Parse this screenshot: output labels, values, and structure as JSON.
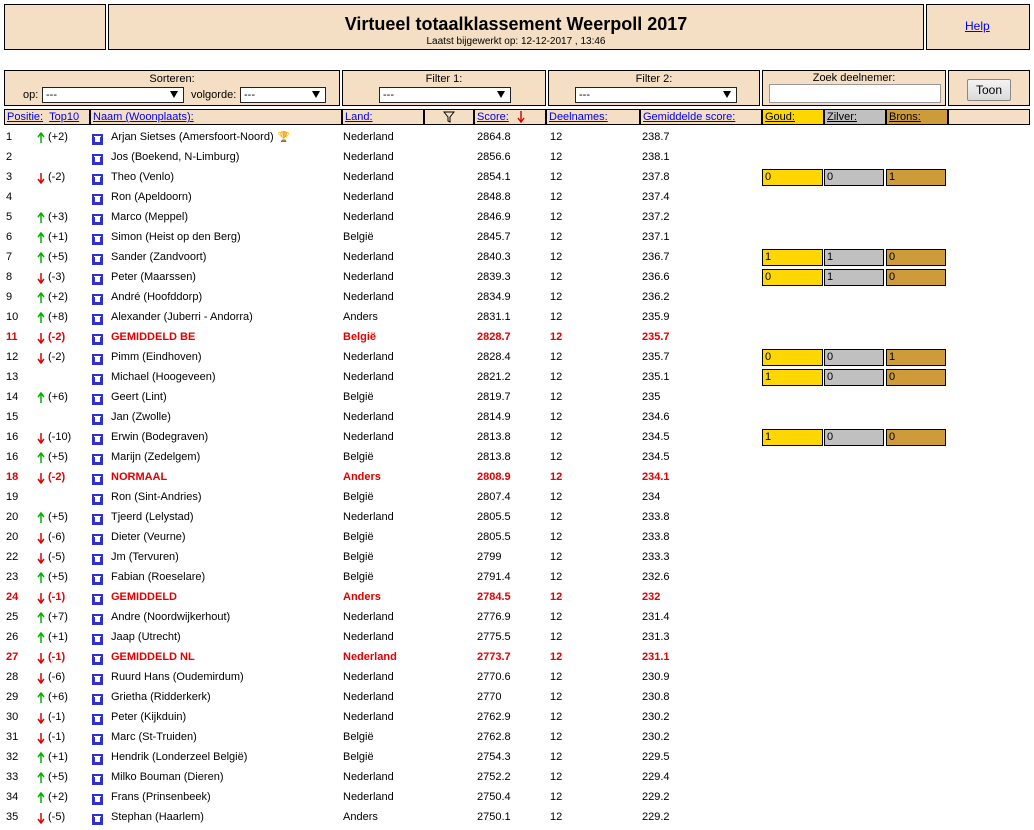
{
  "header": {
    "title": "Virtueel totaalklassement Weerpoll 2017",
    "subtitle": "Laatst bijgewerkt op: 12-12-2017 , 13:46",
    "help_label": "Help"
  },
  "controls": {
    "sort_label": "Sorteren:",
    "op_label": "op:",
    "op_value": "---",
    "volgorde_label": "volgorde:",
    "volgorde_value": "---",
    "filter1_label": "Filter 1:",
    "filter1_value": "---",
    "filter2_label": "Filter 2:",
    "filter2_value": "---",
    "search_label": "Zoek deelnemer:",
    "search_value": "",
    "toon_label": "Toon"
  },
  "columns": {
    "positie": "Positie:",
    "top10": "Top10",
    "naam": "Naam (Woonplaats):",
    "land": "Land:",
    "score": "Score:",
    "deelnames": "Deelnames:",
    "gemiddelde": "Gemiddelde score:",
    "goud": "Goud:",
    "zilver": "Zilver:",
    "brons": "Brons:"
  },
  "colors": {
    "gold": "#ffd700",
    "silver": "#c0c0c0",
    "bronze": "#cd9b3a",
    "highlight": "#e00000",
    "header_bg": "#f5dfc4"
  },
  "rows": [
    {
      "pos": "1",
      "dir": "up",
      "change": "(+2)",
      "name": "Arjan Sietses (Amersfoort-Noord)",
      "trophy": true,
      "land": "Nederland",
      "score": "2864.8",
      "deel": "12",
      "gem": "238.7"
    },
    {
      "pos": "2",
      "dir": "",
      "change": "",
      "name": "Jos (Boekend, N-Limburg)",
      "land": "Nederland",
      "score": "2856.6",
      "deel": "12",
      "gem": "238.1"
    },
    {
      "pos": "3",
      "dir": "down",
      "change": "(-2)",
      "name": "Theo (Venlo)",
      "land": "Nederland",
      "score": "2854.1",
      "deel": "12",
      "gem": "237.8",
      "goud": "0",
      "zilver": "0",
      "brons": "1"
    },
    {
      "pos": "4",
      "dir": "",
      "change": "",
      "name": "Ron (Apeldoorn)",
      "land": "Nederland",
      "score": "2848.8",
      "deel": "12",
      "gem": "237.4"
    },
    {
      "pos": "5",
      "dir": "up",
      "change": "(+3)",
      "name": "Marco (Meppel)",
      "land": "Nederland",
      "score": "2846.9",
      "deel": "12",
      "gem": "237.2"
    },
    {
      "pos": "6",
      "dir": "up",
      "change": "(+1)",
      "name": "Simon (Heist op den Berg)",
      "land": "België",
      "score": "2845.7",
      "deel": "12",
      "gem": "237.1"
    },
    {
      "pos": "7",
      "dir": "up",
      "change": "(+5)",
      "name": "Sander (Zandvoort)",
      "land": "Nederland",
      "score": "2840.3",
      "deel": "12",
      "gem": "236.7",
      "goud": "1",
      "zilver": "1",
      "brons": "0"
    },
    {
      "pos": "8",
      "dir": "down",
      "change": "(-3)",
      "name": "Peter (Maarssen)",
      "land": "Nederland",
      "score": "2839.3",
      "deel": "12",
      "gem": "236.6",
      "goud": "0",
      "zilver": "1",
      "brons": "0"
    },
    {
      "pos": "9",
      "dir": "up",
      "change": "(+2)",
      "name": "André (Hoofddorp)",
      "land": "Nederland",
      "score": "2834.9",
      "deel": "12",
      "gem": "236.2"
    },
    {
      "pos": "10",
      "dir": "up",
      "change": "(+8)",
      "name": "Alexander (Juberri - Andorra)",
      "land": "Anders",
      "score": "2831.1",
      "deel": "12",
      "gem": "235.9"
    },
    {
      "pos": "11",
      "dir": "down",
      "change": "(-2)",
      "name": "GEMIDDELD BE",
      "hl": true,
      "land": "België",
      "score": "2828.7",
      "deel": "12",
      "gem": "235.7"
    },
    {
      "pos": "12",
      "dir": "down",
      "change": "(-2)",
      "name": "Pimm (Eindhoven)",
      "land": "Nederland",
      "score": "2828.4",
      "deel": "12",
      "gem": "235.7",
      "goud": "0",
      "zilver": "0",
      "brons": "1"
    },
    {
      "pos": "13",
      "dir": "",
      "change": "",
      "name": "Michael (Hoogeveen)",
      "land": "Nederland",
      "score": "2821.2",
      "deel": "12",
      "gem": "235.1",
      "goud": "1",
      "zilver": "0",
      "brons": "0"
    },
    {
      "pos": "14",
      "dir": "up",
      "change": "(+6)",
      "name": "Geert (Lint)",
      "land": "België",
      "score": "2819.7",
      "deel": "12",
      "gem": "235"
    },
    {
      "pos": "15",
      "dir": "",
      "change": "",
      "name": "Jan (Zwolle)",
      "land": "Nederland",
      "score": "2814.9",
      "deel": "12",
      "gem": "234.6"
    },
    {
      "pos": "16",
      "dir": "down",
      "change": "(-10)",
      "name": "Erwin (Bodegraven)",
      "land": "Nederland",
      "score": "2813.8",
      "deel": "12",
      "gem": "234.5",
      "goud": "1",
      "zilver": "0",
      "brons": "0"
    },
    {
      "pos": "16",
      "dir": "up",
      "change": "(+5)",
      "name": "Marijn (Zedelgem)",
      "land": "België",
      "score": "2813.8",
      "deel": "12",
      "gem": "234.5"
    },
    {
      "pos": "18",
      "dir": "down",
      "change": "(-2)",
      "name": "NORMAAL",
      "hl": true,
      "land": "Anders",
      "score": "2808.9",
      "deel": "12",
      "gem": "234.1"
    },
    {
      "pos": "19",
      "dir": "",
      "change": "",
      "name": "Ron (Sint-Andries)",
      "land": "België",
      "score": "2807.4",
      "deel": "12",
      "gem": "234"
    },
    {
      "pos": "20",
      "dir": "up",
      "change": "(+5)",
      "name": "Tjeerd (Lelystad)",
      "land": "Nederland",
      "score": "2805.5",
      "deel": "12",
      "gem": "233.8"
    },
    {
      "pos": "20",
      "dir": "down",
      "change": "(-6)",
      "name": "Dieter (Veurne)",
      "land": "België",
      "score": "2805.5",
      "deel": "12",
      "gem": "233.8"
    },
    {
      "pos": "22",
      "dir": "down",
      "change": "(-5)",
      "name": "Jm (Tervuren)",
      "land": "België",
      "score": "2799",
      "deel": "12",
      "gem": "233.3"
    },
    {
      "pos": "23",
      "dir": "up",
      "change": "(+5)",
      "name": "Fabian (Roeselare)",
      "land": "België",
      "score": "2791.4",
      "deel": "12",
      "gem": "232.6"
    },
    {
      "pos": "24",
      "dir": "down",
      "change": "(-1)",
      "name": "GEMIDDELD",
      "hl": true,
      "land": "Anders",
      "score": "2784.5",
      "deel": "12",
      "gem": "232"
    },
    {
      "pos": "25",
      "dir": "up",
      "change": "(+7)",
      "name": "Andre (Noordwijkerhout)",
      "land": "Nederland",
      "score": "2776.9",
      "deel": "12",
      "gem": "231.4"
    },
    {
      "pos": "26",
      "dir": "up",
      "change": "(+1)",
      "name": "Jaap (Utrecht)",
      "land": "Nederland",
      "score": "2775.5",
      "deel": "12",
      "gem": "231.3"
    },
    {
      "pos": "27",
      "dir": "down",
      "change": "(-1)",
      "name": "GEMIDDELD NL",
      "hl": true,
      "land": "Nederland",
      "score": "2773.7",
      "deel": "12",
      "gem": "231.1"
    },
    {
      "pos": "28",
      "dir": "down",
      "change": "(-6)",
      "name": "Ruurd Hans (Oudemirdum)",
      "land": "Nederland",
      "score": "2770.6",
      "deel": "12",
      "gem": "230.9"
    },
    {
      "pos": "29",
      "dir": "up",
      "change": "(+6)",
      "name": "Grietha (Ridderkerk)",
      "land": "Nederland",
      "score": "2770",
      "deel": "12",
      "gem": "230.8"
    },
    {
      "pos": "30",
      "dir": "down",
      "change": "(-1)",
      "name": "Peter (Kijkduin)",
      "land": "Nederland",
      "score": "2762.9",
      "deel": "12",
      "gem": "230.2"
    },
    {
      "pos": "31",
      "dir": "down",
      "change": "(-1)",
      "name": "Marc (St-Truiden)",
      "land": "België",
      "score": "2762.8",
      "deel": "12",
      "gem": "230.2"
    },
    {
      "pos": "32",
      "dir": "up",
      "change": "(+1)",
      "name": "Hendrik (Londerzeel België)",
      "land": "België",
      "score": "2754.3",
      "deel": "12",
      "gem": "229.5"
    },
    {
      "pos": "33",
      "dir": "up",
      "change": "(+5)",
      "name": "Milko Bouman (Dieren)",
      "land": "Nederland",
      "score": "2752.2",
      "deel": "12",
      "gem": "229.4"
    },
    {
      "pos": "34",
      "dir": "up",
      "change": "(+2)",
      "name": "Frans (Prinsenbeek)",
      "land": "Nederland",
      "score": "2750.4",
      "deel": "12",
      "gem": "229.2"
    },
    {
      "pos": "35",
      "dir": "down",
      "change": "(-5)",
      "name": "Stephan (Haarlem)",
      "land": "Anders",
      "score": "2750.1",
      "deel": "12",
      "gem": "229.2"
    }
  ]
}
